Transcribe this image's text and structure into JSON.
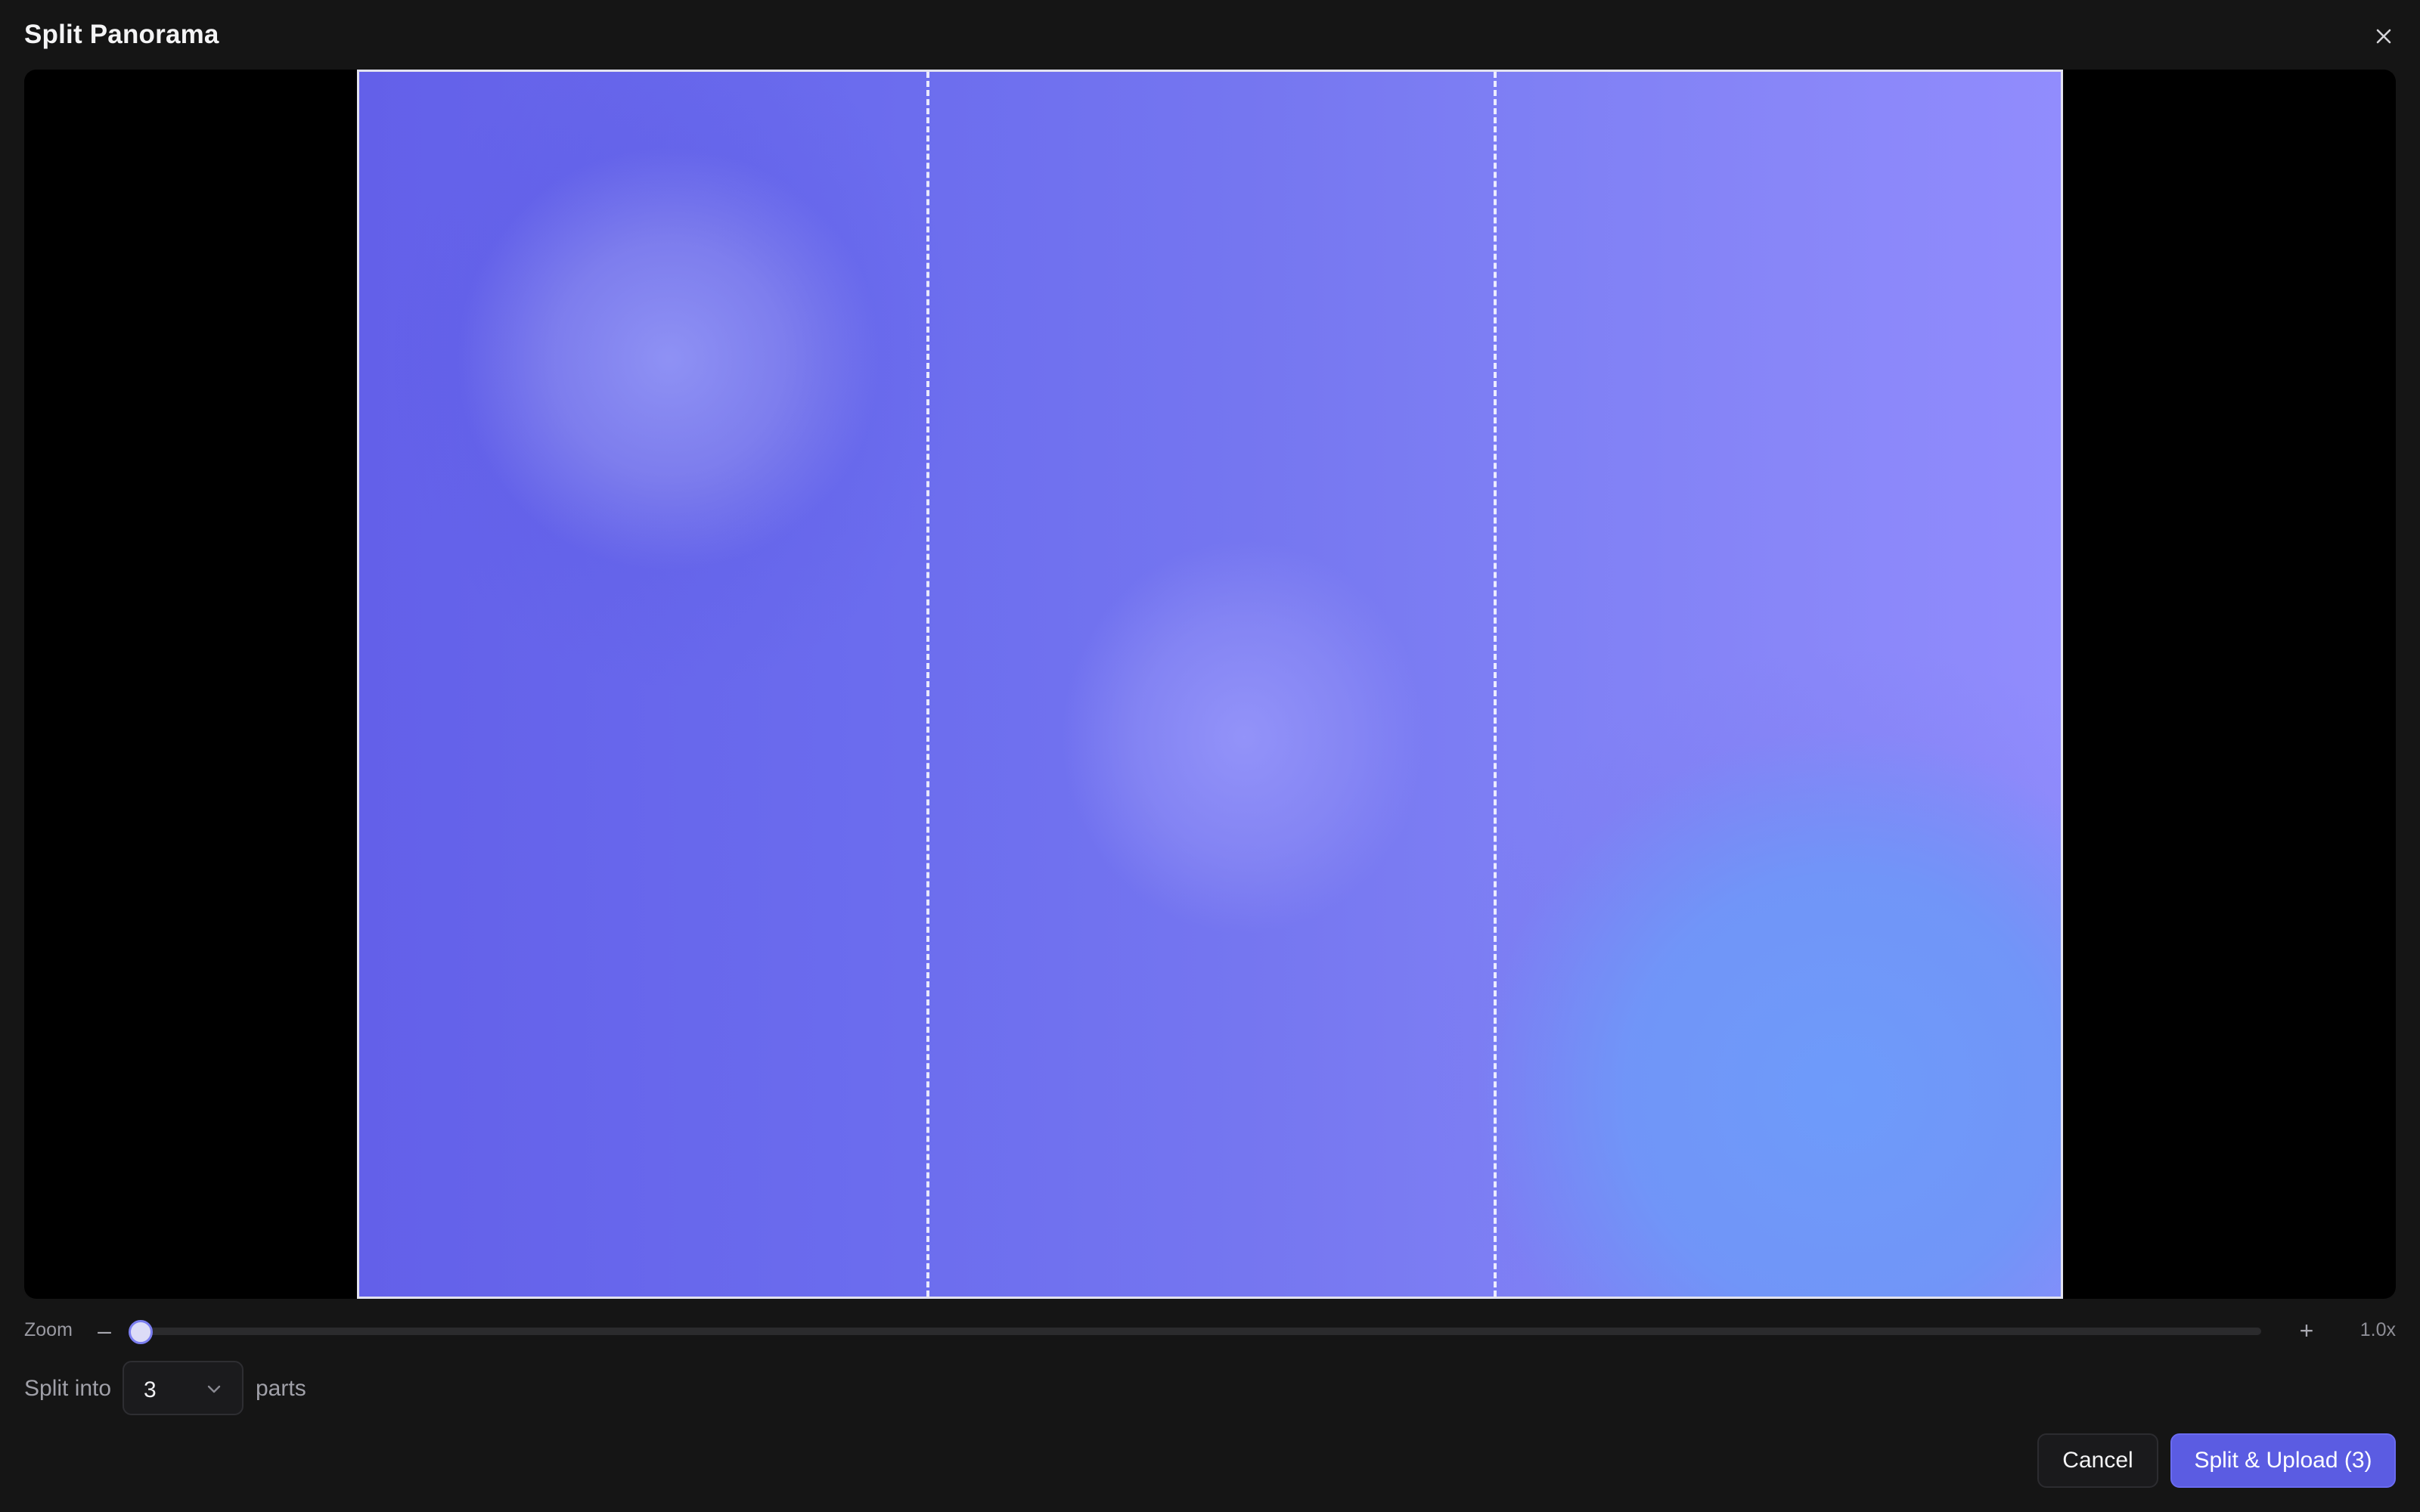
{
  "dialog": {
    "title": "Split Panorama",
    "close_icon": "close-icon"
  },
  "preview": {
    "parts": 3
  },
  "zoom": {
    "label": "Zoom",
    "minus_label": "–",
    "plus_label": "+",
    "value_label": "1.0x",
    "level_fraction": 0
  },
  "split": {
    "label": "Split into",
    "selected_value": "3",
    "suffix": "parts"
  },
  "actions": {
    "cancel_label": "Cancel",
    "primary_label": "Split & Upload (3)"
  },
  "colors": {
    "accent": "#5b5ce2",
    "background": "#151515"
  }
}
